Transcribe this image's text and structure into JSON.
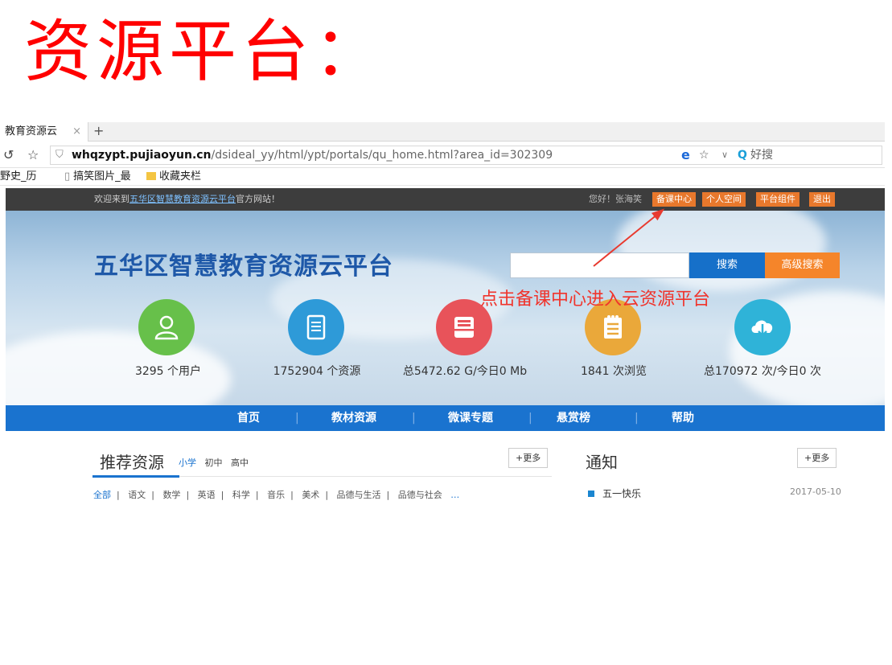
{
  "slide": {
    "title": "资源平台："
  },
  "browser": {
    "tab_title": "教育资源云",
    "tab_close": "×",
    "new_tab": "+",
    "url_domain": "whqzypt.pujiaoyun.cn",
    "url_path": "/dsideal_yy/html/ypt/portals/qu_home.html?area_id=302309",
    "search_engine": "好搜",
    "bookmarks": [
      "野史_历",
      "搞笑图片_最",
      "收藏夹栏"
    ]
  },
  "site": {
    "topbar": {
      "welcome_prefix": "欢迎来到",
      "welcome_link": "五华区智慧教育资源云平台",
      "welcome_suffix": "官方网站！",
      "greeting": "您好！张海笑",
      "buttons": [
        "备课中心",
        "个人空间",
        "平台组件",
        "退出"
      ]
    },
    "title": "五华区智慧教育资源云平台",
    "search_button": "搜索",
    "advanced_search_button": "高级搜索",
    "stats": [
      {
        "label": "3295  个用户",
        "color": "#67c04a",
        "icon": "user-icon"
      },
      {
        "label": "1752904  个资源",
        "color": "#2e9ad8",
        "icon": "document-icon"
      },
      {
        "label": "总5472.62 G/今日0 Mb",
        "color": "#e8535a",
        "icon": "storage-icon"
      },
      {
        "label": "1841  次浏览",
        "color": "#eaa83a",
        "icon": "notepad-icon"
      },
      {
        "label": "总170972 次/今日0 次",
        "color": "#2fb3d8",
        "icon": "cloud-download-icon"
      }
    ],
    "nav": [
      "首页",
      "教材资源",
      "微课专题",
      "悬赏榜",
      "帮助"
    ],
    "nav_separator": "|"
  },
  "recommended": {
    "title": "推荐资源",
    "grades": [
      "小学",
      "初中",
      "高中"
    ],
    "more": "+更多",
    "subjects": [
      "全部",
      "语文",
      "数学",
      "英语",
      "科学",
      "音乐",
      "美术",
      "品德与生活",
      "品德与社会"
    ],
    "subjects_ellipsis": "…",
    "separator": "|"
  },
  "notice": {
    "title": "通知",
    "more": "+更多",
    "items": [
      {
        "title": "五一快乐",
        "date": "2017-05-10"
      }
    ]
  },
  "annotation": {
    "text": "点击备课中心进入云资源平台"
  }
}
